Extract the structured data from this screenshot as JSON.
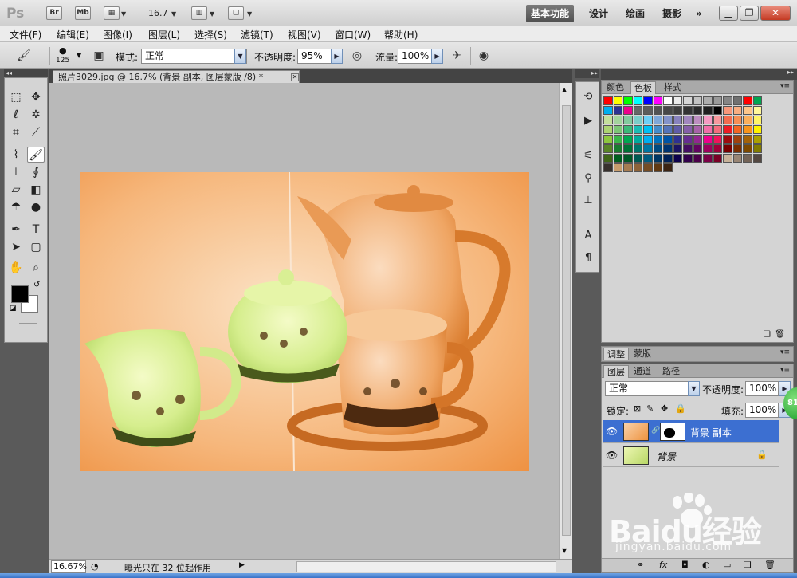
{
  "app": {
    "logo": "Ps",
    "bridge": "Br",
    "minibridge": "Mb",
    "zoom": "16.7",
    "workspaces": [
      "基本功能",
      "设计",
      "绘画",
      "摄影"
    ],
    "more": "»"
  },
  "menu": [
    "文件(F)",
    "编辑(E)",
    "图像(I)",
    "图层(L)",
    "选择(S)",
    "滤镜(T)",
    "视图(V)",
    "窗口(W)",
    "帮助(H)"
  ],
  "options": {
    "brush_size": "125",
    "mode_label": "模式:",
    "mode_value": "正常",
    "opacity_label": "不透明度:",
    "opacity_value": "95%",
    "flow_label": "流量:",
    "flow_value": "100%"
  },
  "document": {
    "tab_title": "照片3029.jpg @ 16.7% (背景 副本, 图层蒙版 /8) *",
    "zoom_status": "16.67%",
    "status_text": "曝光只在 32 位起作用"
  },
  "swatches_panel": {
    "tabs": [
      "颜色",
      "色板",
      "样式"
    ],
    "active_tab": "色板",
    "colors": [
      "#ff0000",
      "#ffff00",
      "#00ff00",
      "#00ffff",
      "#0000ff",
      "#ff00ff",
      "#ffffff",
      "#ebebeb",
      "#d6d6d6",
      "#c2c2c2",
      "#adadad",
      "#999999",
      "#858585",
      "#707070",
      "#ff0000",
      "#00a651",
      "#00aeef",
      "#2e3192",
      "#ec008c",
      "#666666",
      "#5c5c5c",
      "#525252",
      "#474747",
      "#3d3d3d",
      "#333333",
      "#292929",
      "#1f1f1f",
      "#000000",
      "#f7977a",
      "#f9ad81",
      "#fdc68a",
      "#fff79a",
      "#c4df9b",
      "#a3d39c",
      "#82ca9d",
      "#7bcdc8",
      "#6ecff6",
      "#7ea7d8",
      "#8493ca",
      "#8882be",
      "#a187be",
      "#bc8dbf",
      "#f49ac2",
      "#f6989d",
      "#f26c4f",
      "#f68e55",
      "#fbaf5c",
      "#fff467",
      "#acd372",
      "#7cc576",
      "#3bb878",
      "#1abbb4",
      "#00bff3",
      "#438cca",
      "#5574b9",
      "#605ca8",
      "#855fa8",
      "#a763a8",
      "#f06ea9",
      "#f26d7d",
      "#ed1c24",
      "#f26522",
      "#f7941d",
      "#fff200",
      "#8dc73f",
      "#39b54a",
      "#00a651",
      "#00a99d",
      "#00aeef",
      "#0072bc",
      "#0054a6",
      "#2e3192",
      "#662d91",
      "#92278f",
      "#ec008c",
      "#ed145b",
      "#9e0b0f",
      "#a0410d",
      "#a36209",
      "#aba000",
      "#598527",
      "#197b30",
      "#007236",
      "#00746b",
      "#0076a3",
      "#004a80",
      "#003471",
      "#1b1464",
      "#440e62",
      "#630460",
      "#9e005d",
      "#9e0039",
      "#790000",
      "#7b2e00",
      "#7d4900",
      "#827b00",
      "#406618",
      "#005e20",
      "#005826",
      "#005952",
      "#005b7f",
      "#003663",
      "#002157",
      "#0d004c",
      "#32004b",
      "#4b0049",
      "#7b0046",
      "#7a0026",
      "#c7b299",
      "#998675",
      "#736357",
      "#534741",
      "#37302d",
      "#c69c6d",
      "#a67c52",
      "#8c6239",
      "#754c24",
      "#603913",
      "#3c2412"
    ]
  },
  "adjust_panel": {
    "tabs": [
      "调整",
      "蒙版"
    ]
  },
  "layers_panel": {
    "tabs": [
      "图层",
      "通道",
      "路径"
    ],
    "blend_mode": "正常",
    "opacity_label": "不透明度:",
    "opacity_value": "100%",
    "lock_label": "锁定:",
    "fill_label": "填充:",
    "fill_value": "100%",
    "layers": [
      {
        "name": "背景 副本",
        "selected": true
      },
      {
        "name": "背景",
        "selected": false
      }
    ]
  },
  "overlay": {
    "badge": "81",
    "watermark_brand": "Baidu经验",
    "watermark_url": "jingyan.baidu.com"
  }
}
